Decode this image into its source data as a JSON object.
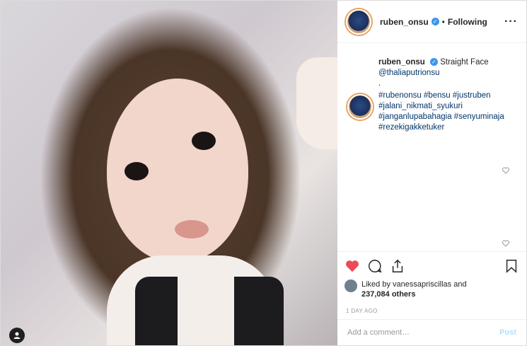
{
  "header": {
    "username": "ruben_onsu",
    "verified_mark": "✓",
    "separator": "•",
    "follow_status": "Following",
    "more_label": "···"
  },
  "caption": {
    "username": "ruben_onsu",
    "text": "Straight Face",
    "mention": "@thaliaputrionsu",
    "dot": ".",
    "hashtags": "#rubenonsu #bensu #justruben #jalani_nikmati_syukuri #janganlupabahagia #senyuminaja #rezekigakketuker"
  },
  "likes": {
    "line1": "Liked by vanessapriscillas and",
    "line2": "237,084 others"
  },
  "time_ago": "1 DAY AGO",
  "comment_box": {
    "placeholder": "Add a comment…",
    "post_label": "Post"
  },
  "icons": [
    "heart-icon",
    "comment-icon",
    "share-icon",
    "bookmark-icon",
    "user-tag-icon",
    "like-comment-icon"
  ],
  "colors": {
    "heart": "#ed4956",
    "link": "#003569",
    "verified": "#3897f0",
    "post_disabled": "#b2dffc"
  }
}
